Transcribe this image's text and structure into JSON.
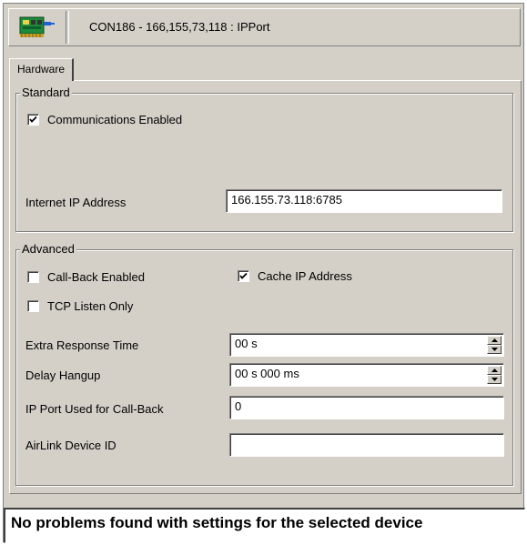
{
  "header": {
    "title": "CON186 - 166,155,73,118 : IPPort",
    "icon": "network-card-icon"
  },
  "tabs": [
    {
      "label": "Hardware",
      "selected": true
    }
  ],
  "standard": {
    "legend": "Standard",
    "communications_enabled": {
      "label": "Communications Enabled",
      "checked": true
    },
    "ip_address": {
      "label": "Internet IP Address",
      "value": "166.155.73.118:6785"
    }
  },
  "advanced": {
    "legend": "Advanced",
    "call_back_enabled": {
      "label": "Call-Back Enabled",
      "checked": false
    },
    "cache_ip_address": {
      "label": "Cache IP Address",
      "checked": true
    },
    "tcp_listen_only": {
      "label": "TCP Listen Only",
      "checked": false
    },
    "extra_response_time": {
      "label": "Extra Response Time",
      "value": "00 s"
    },
    "delay_hangup": {
      "label": "Delay Hangup",
      "value": "00 s 000 ms"
    },
    "ip_port_call_back": {
      "label": "IP Port Used for Call-Back",
      "value": "0"
    },
    "airlink_device_id": {
      "label": "AirLink Device ID",
      "value": ""
    }
  },
  "status": {
    "message": "No problems found with settings for the selected device"
  },
  "colors": {
    "face": "#d4d0c8",
    "shadow": "#808080",
    "highlight": "#ffffff"
  }
}
